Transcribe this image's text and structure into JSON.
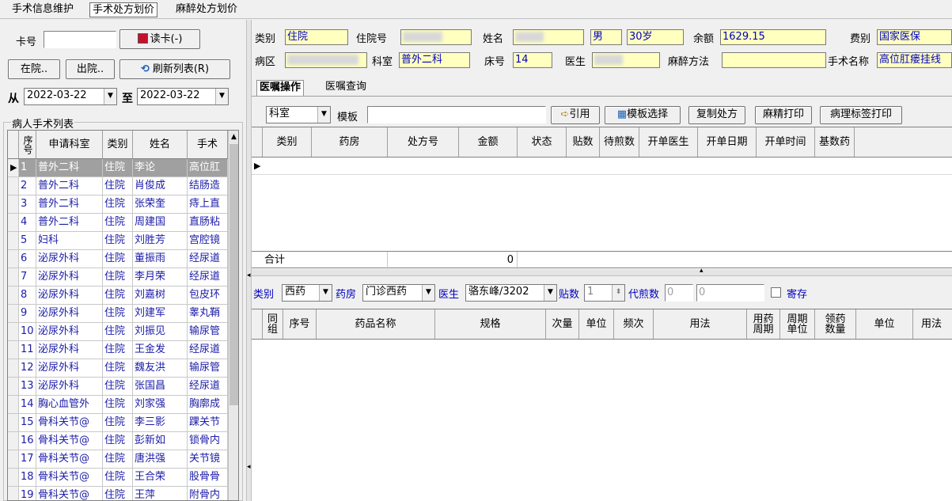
{
  "menu": {
    "tabs": [
      "手术信息维护",
      "手术处方划价",
      "麻醉处方划价"
    ],
    "active": 1
  },
  "left": {
    "card_label": "卡号",
    "card_value": "",
    "read_card_label": "读卡(-)",
    "in_hospital_label": "在院..",
    "discharge_label": "出院..",
    "refresh_label": "刷新列表(R)",
    "from_label": "从",
    "from_date": "2022-03-22",
    "to_label": "至",
    "to_date": "2022-03-22",
    "group_title": "病人手术列表",
    "columns": [
      "序号",
      "申请科室",
      "类别",
      "姓名",
      "手术"
    ],
    "rows": [
      {
        "no": "1",
        "dept": "普外二科",
        "type": "住院",
        "name": "李论",
        "op": "高位肛"
      },
      {
        "no": "2",
        "dept": "普外二科",
        "type": "住院",
        "name": "肖俊成",
        "op": "结肠造"
      },
      {
        "no": "3",
        "dept": "普外二科",
        "type": "住院",
        "name": "张荣奎",
        "op": "痔上直"
      },
      {
        "no": "4",
        "dept": "普外二科",
        "type": "住院",
        "name": "周建国",
        "op": "直肠粘"
      },
      {
        "no": "5",
        "dept": "妇科",
        "type": "住院",
        "name": "刘胜芳",
        "op": "宫腔镜"
      },
      {
        "no": "6",
        "dept": "泌尿外科",
        "type": "住院",
        "name": "董振雨",
        "op": "经尿道"
      },
      {
        "no": "7",
        "dept": "泌尿外科",
        "type": "住院",
        "name": "李月荣",
        "op": "经尿道"
      },
      {
        "no": "8",
        "dept": "泌尿外科",
        "type": "住院",
        "name": "刘嘉树",
        "op": "包皮环"
      },
      {
        "no": "9",
        "dept": "泌尿外科",
        "type": "住院",
        "name": "刘建军",
        "op": "睾丸鞘"
      },
      {
        "no": "10",
        "dept": "泌尿外科",
        "type": "住院",
        "name": "刘振见",
        "op": "输尿管"
      },
      {
        "no": "11",
        "dept": "泌尿外科",
        "type": "住院",
        "name": "王金发",
        "op": "经尿道"
      },
      {
        "no": "12",
        "dept": "泌尿外科",
        "type": "住院",
        "name": "魏友洪",
        "op": "输尿管"
      },
      {
        "no": "13",
        "dept": "泌尿外科",
        "type": "住院",
        "name": "张国昌",
        "op": "经尿道"
      },
      {
        "no": "14",
        "dept": "胸心血管外",
        "type": "住院",
        "name": "刘家强",
        "op": "胸廓成"
      },
      {
        "no": "15",
        "dept": "骨科关节@",
        "type": "住院",
        "name": "李三影",
        "op": "踝关节"
      },
      {
        "no": "16",
        "dept": "骨科关节@",
        "type": "住院",
        "name": "彭新如",
        "op": "锁骨内"
      },
      {
        "no": "17",
        "dept": "骨科关节@",
        "type": "住院",
        "name": "唐洪强",
        "op": "关节镜"
      },
      {
        "no": "18",
        "dept": "骨科关节@",
        "type": "住院",
        "name": "王合荣",
        "op": "股骨骨"
      },
      {
        "no": "19",
        "dept": "骨科关节@",
        "type": "住院",
        "name": "王萍",
        "op": "附骨内"
      }
    ]
  },
  "patient": {
    "category_label": "类别",
    "category": "住院",
    "inpatient_no_label": "住院号",
    "inpatient_no": "",
    "name_label": "姓名",
    "name": "",
    "gender": "男",
    "age": "30岁",
    "balance_label": "余额",
    "balance": "1629.15",
    "fee_type_label": "费别",
    "fee_type": "国家医保",
    "ward_label": "病区",
    "ward": "",
    "dept_label": "科室",
    "dept": "普外二科",
    "bed_label": "床号",
    "bed": "14",
    "doctor_label": "医生",
    "doctor": "",
    "anesthesia_label": "麻醉方法",
    "anesthesia": "",
    "surgery_name_label": "手术名称",
    "surgery_name": "高位肛瘘挂线"
  },
  "tabs": [
    "医嘱操作",
    "医嘱查询"
  ],
  "toolbar": {
    "dept_select": "科室",
    "template_label": "模板",
    "template_value": "",
    "quote_label": "引用",
    "template_select_label": "模板选择",
    "copy_rx_label": "复制处方",
    "narcotic_print_label": "麻精打印",
    "pathology_print_label": "病理标签打印"
  },
  "rx_grid": {
    "columns": [
      "类别",
      "药房",
      "处方号",
      "金额",
      "状态",
      "贴数",
      "待煎数",
      "开单医生",
      "开单日期",
      "开单时间",
      "基数药"
    ],
    "total_label": "合计",
    "total_amount": "0"
  },
  "drug_filter": {
    "category_label": "类别",
    "category": "西药",
    "pharmacy_label": "药房",
    "pharmacy": "门诊西药",
    "doctor_label": "医生",
    "doctor": "骆东峰/3202",
    "doses_label": "贴数",
    "doses": "1",
    "decoct_label": "代煎数",
    "decoct": "0",
    "decoct2": "0",
    "deposit_label": "寄存"
  },
  "drug_grid": {
    "columns": [
      "同组",
      "序号",
      "药品名称",
      "规格",
      "次量",
      "单位",
      "频次",
      "用法",
      "用药周期",
      "周期单位",
      "领药数量",
      "单位",
      "用法"
    ]
  }
}
